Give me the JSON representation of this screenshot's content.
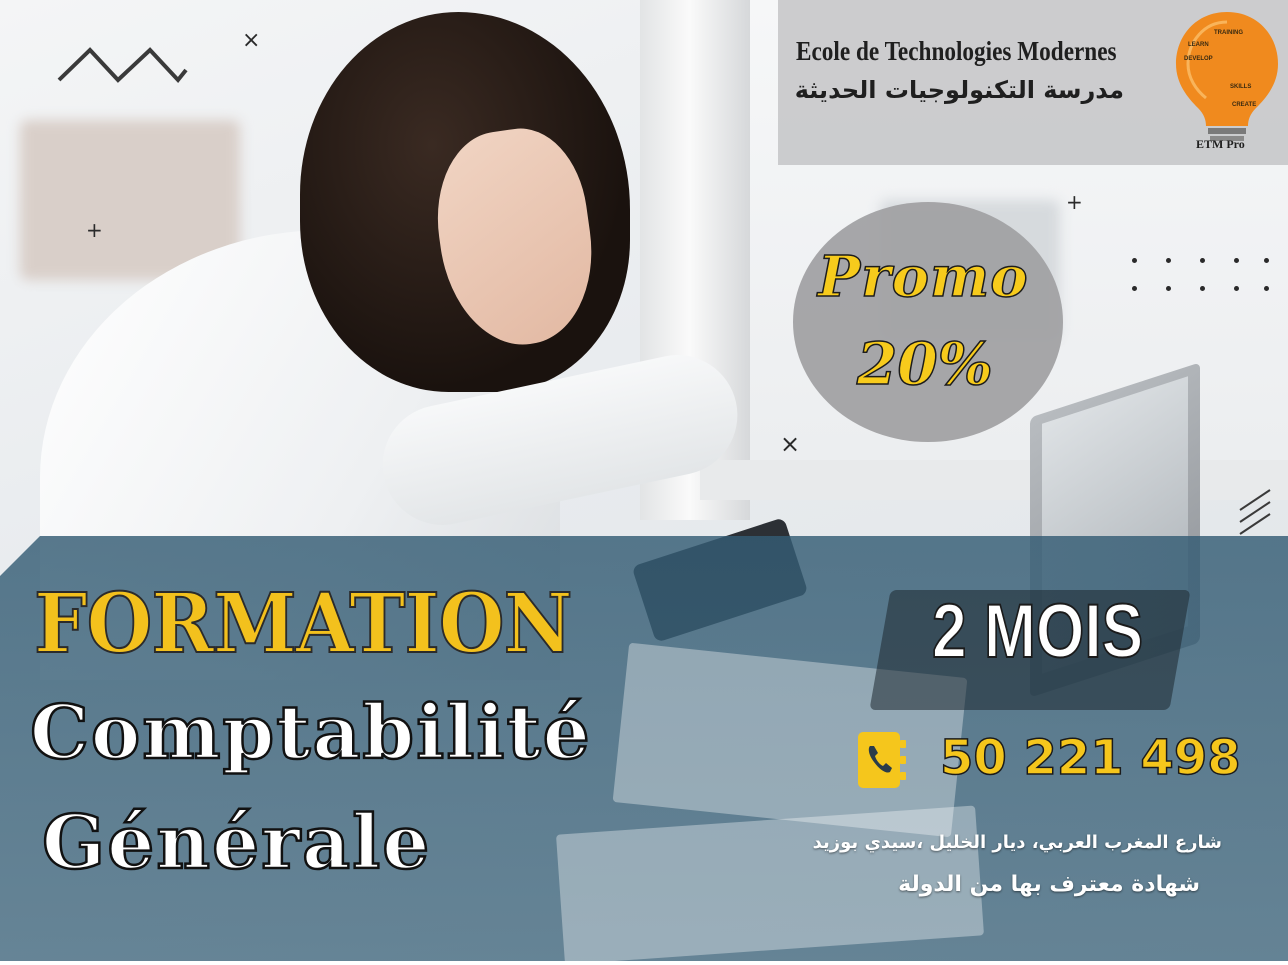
{
  "header": {
    "school_name_fr": "Ecole de Technologies Modernes",
    "school_name_ar": "مدرسة التكنولوجيات الحديثة",
    "logo": {
      "icon": "lightbulb-icon",
      "brand": "ETM Pro",
      "words": [
        "TRAINING",
        "LEARN",
        "DEVELOP",
        "SKILLS",
        "CREATE"
      ],
      "color": "#f08a1e"
    }
  },
  "promo": {
    "line1": "Promo",
    "line2": "20%"
  },
  "course": {
    "label": "FORMATION",
    "title_line1": "Comptabilité",
    "title_line2": "Générale",
    "duration": "2 MOIS"
  },
  "contact": {
    "phone_icon": "phone-book-icon",
    "phone": "50 221 498",
    "address": "شارع المغرب العربي، ديار الخليل ،سيدي بوزيد",
    "certificate": "شهادة معترف بها من الدولة"
  },
  "colors": {
    "accent_yellow": "#f3c11d",
    "overlay_blue": "#345c74",
    "header_grey": "#c8c8ca",
    "promo_grey": "#a0a0a2"
  }
}
